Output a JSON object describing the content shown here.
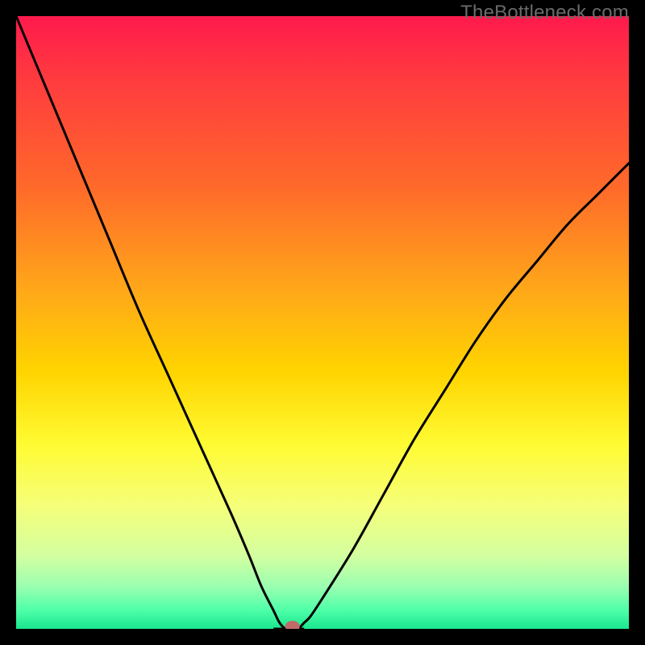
{
  "watermark": "TheBottleneck.com",
  "chart_data": {
    "type": "line",
    "title": "",
    "xlabel": "",
    "ylabel": "",
    "xlim": [
      0,
      100
    ],
    "ylim": [
      0,
      100
    ],
    "grid": false,
    "legend": false,
    "gradient_stops": [
      {
        "pos": 0,
        "color": "#ff1a4d"
      },
      {
        "pos": 10,
        "color": "#ff3a3f"
      },
      {
        "pos": 28,
        "color": "#ff6a2a"
      },
      {
        "pos": 44,
        "color": "#ffa51a"
      },
      {
        "pos": 58,
        "color": "#ffd400"
      },
      {
        "pos": 70,
        "color": "#fffb33"
      },
      {
        "pos": 80,
        "color": "#f5ff7a"
      },
      {
        "pos": 88,
        "color": "#d4ffa0"
      },
      {
        "pos": 93,
        "color": "#9cffb0"
      },
      {
        "pos": 97,
        "color": "#4dffa8"
      },
      {
        "pos": 100,
        "color": "#19e68e"
      }
    ],
    "series": [
      {
        "name": "bottleneck-curve",
        "x": [
          0,
          5,
          10,
          15,
          20,
          25,
          30,
          35,
          38,
          40,
          42,
          43,
          44,
          45,
          46,
          47,
          48,
          50,
          55,
          60,
          65,
          70,
          75,
          80,
          85,
          90,
          95,
          100
        ],
        "y": [
          100,
          88,
          76,
          64,
          52,
          41,
          30,
          19,
          12,
          7,
          3,
          1,
          0,
          0,
          0,
          1,
          2,
          5,
          13,
          22,
          31,
          39,
          47,
          54,
          60,
          66,
          71,
          76
        ]
      }
    ],
    "min_point": {
      "x": 45.1,
      "y": 0
    },
    "flat_segment": {
      "x_start": 42,
      "x_end": 47,
      "y": 0
    }
  }
}
